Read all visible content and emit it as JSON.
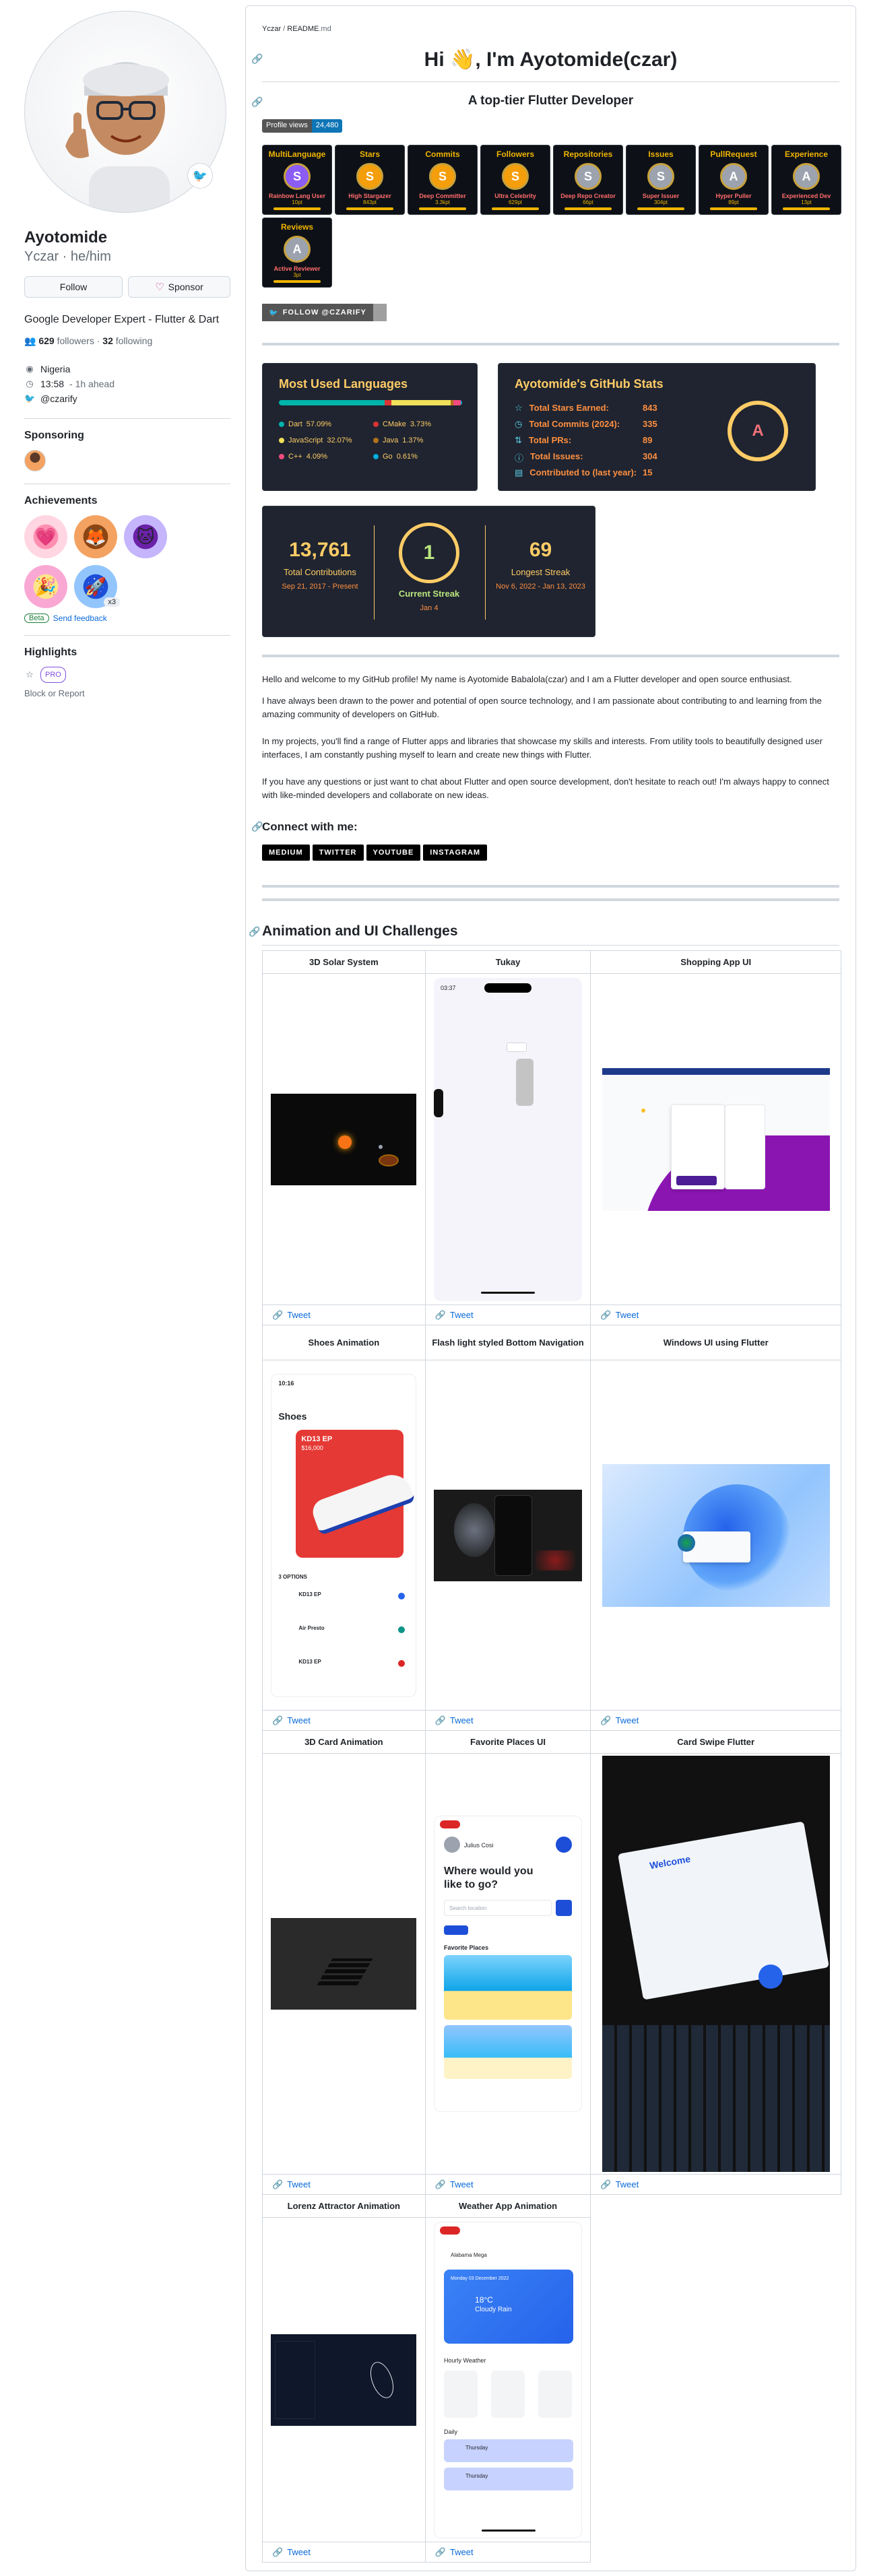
{
  "profile": {
    "name": "Ayotomide",
    "username": "Yczar",
    "pronouns": "he/him",
    "status_emoji": "🐦",
    "follow_label": "Follow",
    "sponsor_label": "Sponsor",
    "bio": "Google Developer Expert - Flutter & Dart",
    "followers": "629",
    "followers_label": "followers",
    "following": "32",
    "following_label": "following",
    "location": "Nigeria",
    "local_time": "13:58",
    "time_note": "- 1h ahead",
    "twitter": "@czarify"
  },
  "sidebar": {
    "sponsoring_title": "Sponsoring",
    "achievements_title": "Achievements",
    "achievement_extra": "x3",
    "beta_label": "Beta",
    "feedback_label": "Send feedback",
    "highlights_title": "Highlights",
    "pro_label": "PRO",
    "block_label": "Block or Report"
  },
  "readme": {
    "breadcrumb_user": "Yczar",
    "breadcrumb_sep": " / ",
    "breadcrumb_file": "README",
    "breadcrumb_ext": ".md",
    "title": "Hi 👋, I'm Ayotomide(czar)",
    "subtitle": "A top-tier Flutter Developer",
    "views_label": "Profile views",
    "views_count": "24,480",
    "follow_badge": "FOLLOW @CZARIFY",
    "trophies": [
      {
        "title": "MultiLanguage",
        "rank": "S",
        "sub": "Rainbow Lang User",
        "pts": "10pt",
        "color": "#8b5cf6"
      },
      {
        "title": "Stars",
        "rank": "S",
        "sub": "High Stargazer",
        "pts": "843pt",
        "color": "#f59e0b"
      },
      {
        "title": "Commits",
        "rank": "S",
        "sub": "Deep Committer",
        "pts": "3.3kpt",
        "color": "#f59e0b"
      },
      {
        "title": "Followers",
        "rank": "S",
        "sub": "Ultra Celebrity",
        "pts": "629pt",
        "color": "#f59e0b"
      },
      {
        "title": "Repositories",
        "rank": "S",
        "sub": "Deep Repo Creator",
        "pts": "66pt",
        "color": "#9ca3af"
      },
      {
        "title": "Issues",
        "rank": "S",
        "sub": "Super Issuer",
        "pts": "304pt",
        "color": "#9ca3af"
      },
      {
        "title": "PullRequest",
        "rank": "A",
        "sub": "Hyper Puller",
        "pts": "89pt",
        "color": "#9ca3af"
      },
      {
        "title": "Experience",
        "rank": "A",
        "sub": "Experienced Dev",
        "pts": "13pt",
        "color": "#9ca3af"
      },
      {
        "title": "Reviews",
        "rank": "A",
        "sub": "Active Reviewer",
        "pts": "3pt",
        "color": "#9ca3af"
      }
    ],
    "languages": {
      "title": "Most Used Languages",
      "items": [
        {
          "name": "Dart",
          "pct": "57.09%",
          "color": "#00b4ab",
          "value": 57.09
        },
        {
          "name": "CMake",
          "pct": "3.73%",
          "color": "#da3434",
          "value": 3.73
        },
        {
          "name": "JavaScript",
          "pct": "32.07%",
          "color": "#f1e05a",
          "value": 32.07
        },
        {
          "name": "Java",
          "pct": "1.37%",
          "color": "#b07219",
          "value": 1.37
        },
        {
          "name": "C++",
          "pct": "4.09%",
          "color": "#f34b7d",
          "value": 4.09
        },
        {
          "name": "Go",
          "pct": "0.61%",
          "color": "#00add8",
          "value": 0.61
        }
      ]
    },
    "stats": {
      "title": "Ayotomide's GitHub Stats",
      "rows": [
        {
          "icon": "☆",
          "label": "Total Stars Earned:",
          "value": "843"
        },
        {
          "icon": "◷",
          "label": "Total Commits (2024):",
          "value": "335"
        },
        {
          "icon": "⇅",
          "label": "Total PRs:",
          "value": "89"
        },
        {
          "icon": "ⓘ",
          "label": "Total Issues:",
          "value": "304"
        },
        {
          "icon": "▤",
          "label": "Contributed to (last year):",
          "value": "15"
        }
      ],
      "grade": "A"
    },
    "streak": {
      "total": "13,761",
      "total_label": "Total Contributions",
      "total_range": "Sep 21, 2017 - Present",
      "current": "1",
      "current_label": "Current Streak",
      "current_date": "Jan 4",
      "longest": "69",
      "longest_label": "Longest Streak",
      "longest_range": "Nov 6, 2022 - Jan 13, 2023"
    },
    "paragraphs": [
      "Hello and welcome to my GitHub profile! My name is Ayotomide Babalola(czar) and I am a Flutter developer and open source enthusiast.",
      "I have always been drawn to the power and potential of open source technology, and I am passionate about contributing to and learning from the amazing community of developers on GitHub.",
      "In my projects, you'll find a range of Flutter apps and libraries that showcase my skills and interests. From utility tools to beautifully designed user interfaces, I am constantly pushing myself to learn and create new things with Flutter.",
      "If you have any questions or just want to chat about Flutter and open source development, don't hesitate to reach out! I'm always happy to connect with like-minded developers and collaborate on new ideas."
    ],
    "connect_title": "Connect with me:",
    "social": [
      "MEDIUM",
      "TWITTER",
      "YOUTUBE",
      "INSTAGRAM"
    ],
    "section_title": "Animation and UI Challenges",
    "tweet_label": "Tweet",
    "demos": [
      {
        "title": "3D Solar System"
      },
      {
        "title": "Tukay"
      },
      {
        "title": "Shopping App UI"
      },
      {
        "title": "Shoes Animation"
      },
      {
        "title": "Flash light styled Bottom Navigation"
      },
      {
        "title": "Windows UI using Flutter"
      },
      {
        "title": "3D Card Animation"
      },
      {
        "title": "Favorite Places UI"
      },
      {
        "title": "Card Swipe Flutter"
      },
      {
        "title": "Lorenz Attractor Animation"
      },
      {
        "title": "Weather App Animation"
      }
    ],
    "shot_text": {
      "phone_time": "03:37",
      "shoes_time": "10:16",
      "shoes_heading": "Shoes",
      "shoes_product": "KD13 EP",
      "shoes_price": "$16,000",
      "shoes_options": "3 OPTIONS",
      "shoes_list": [
        "KD13 EP",
        "Air Presto",
        "KD13 EP"
      ],
      "places_user": "Julius Cosi",
      "places_q": "Where would you like to go?",
      "places_search": "Search location",
      "places_fav": "Favorite Places",
      "weather_loc": "Alabama Mega",
      "weather_date": "Monday 03 December 2022",
      "weather_temp": "18°C",
      "weather_desc": "Cloudy Rain",
      "weather_hourly": "Hourly Weather",
      "weather_daily": "Daily",
      "weather_day": "Thursday",
      "card_welcome": "Welcome"
    }
  },
  "colors": {
    "link": "#0969da",
    "border": "#d0d7de",
    "card_bg": "#1f2430",
    "accent_gold": "#ffcc66"
  }
}
